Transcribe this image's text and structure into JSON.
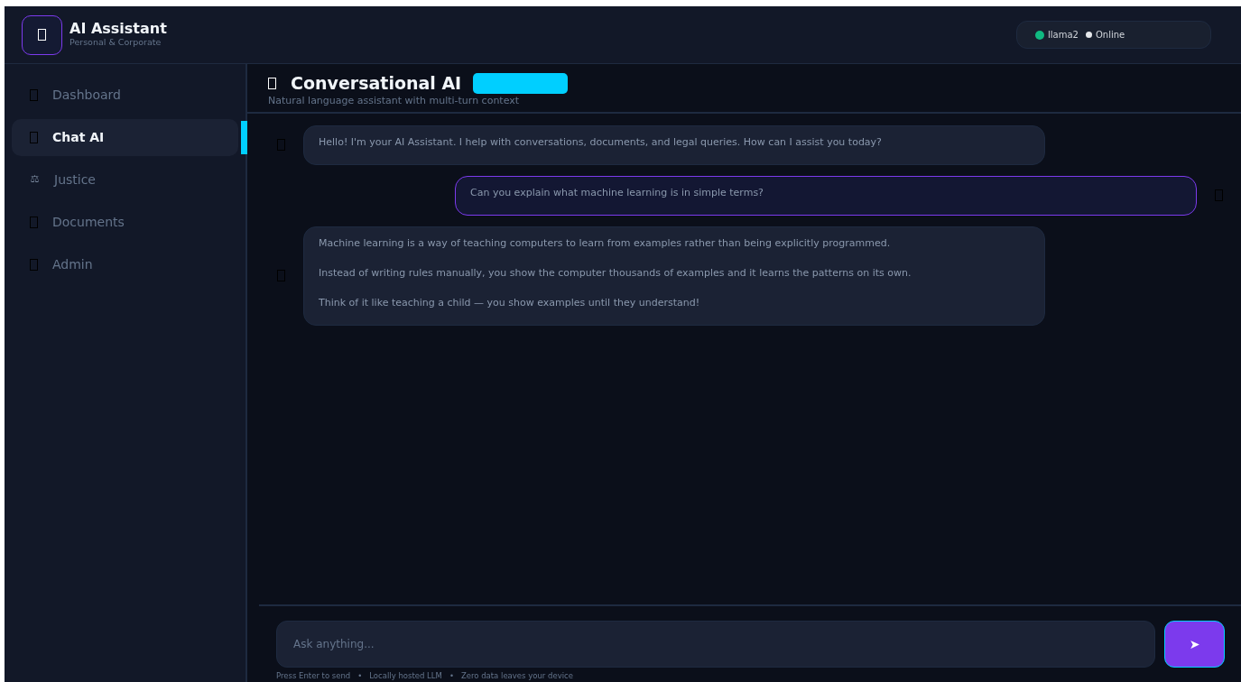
{
  "brand": {
    "title": "AI Assistant",
    "subtitle": "Personal & Corporate"
  },
  "status": {
    "model": "llama2",
    "state": "Online"
  },
  "sidebar": {
    "items": [
      {
        "label": "Dashboard",
        "selected": false
      },
      {
        "label": "Chat AI",
        "selected": true
      },
      {
        "label": "Justice",
        "icon": "⚖",
        "selected": false
      },
      {
        "label": "Documents",
        "selected": false
      },
      {
        "label": "Admin",
        "selected": false
      }
    ]
  },
  "page": {
    "title": "Conversational AI",
    "subtitle": "Natural language assistant with multi-turn context"
  },
  "messages": [
    {
      "kind": "assistant",
      "paragraphs": [
        "Hello! I'm your AI Assistant. I help with conversations, documents, and legal queries. How can I assist you today?"
      ]
    },
    {
      "kind": "user",
      "paragraphs": [
        "Can you explain what machine learning is in simple terms?"
      ]
    },
    {
      "kind": "assistant",
      "paragraphs": [
        "Machine learning is a way of teaching computers to learn from examples rather than being explicitly programmed.",
        "Instead of writing rules manually, you show the computer thousands of examples and it learns the patterns on its own.",
        "Think of it like teaching a child — you show examples until they understand!"
      ]
    }
  ],
  "composer": {
    "placeholder": "Ask anything...",
    "send": "➤"
  },
  "hints": [
    "Press Enter to send",
    "•",
    "Locally hosted LLM",
    "•",
    "Zero data leaves your device"
  ]
}
